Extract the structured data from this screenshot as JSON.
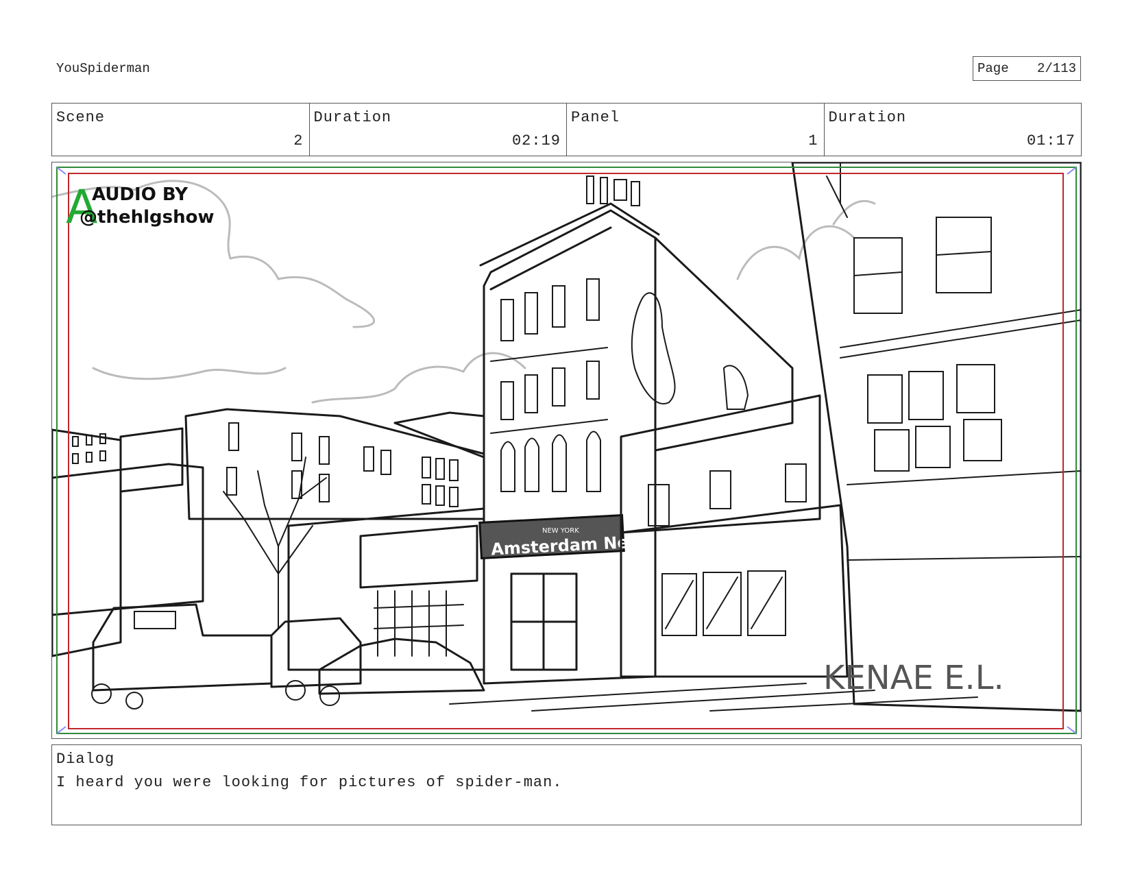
{
  "header": {
    "project_title": "YouSpiderman",
    "page_label": "Page",
    "page_number": "2/113"
  },
  "info": {
    "scene_label": "Scene",
    "scene_value": "2",
    "scene_duration_label": "Duration",
    "scene_duration_value": "02:19",
    "panel_label": "Panel",
    "panel_value": "1",
    "panel_duration_label": "Duration",
    "panel_duration_value": "01:17"
  },
  "panel": {
    "audio_credit_line1": "AUDIO BY",
    "audio_credit_line2": "@thehlgshow",
    "marker_letter": "A",
    "sign_small": "NEW YORK",
    "sign_main": "Amsterdam News",
    "artist_signature": "KENAE E.L."
  },
  "dialog": {
    "label": "Dialog",
    "text": "I heard you were looking for pictures of spider-man."
  },
  "colors": {
    "safe_frame_outer": "#2e8b3a",
    "safe_frame_inner": "#c0262c",
    "marker": "#22aa33",
    "building_fill": "#d6d6d6"
  }
}
